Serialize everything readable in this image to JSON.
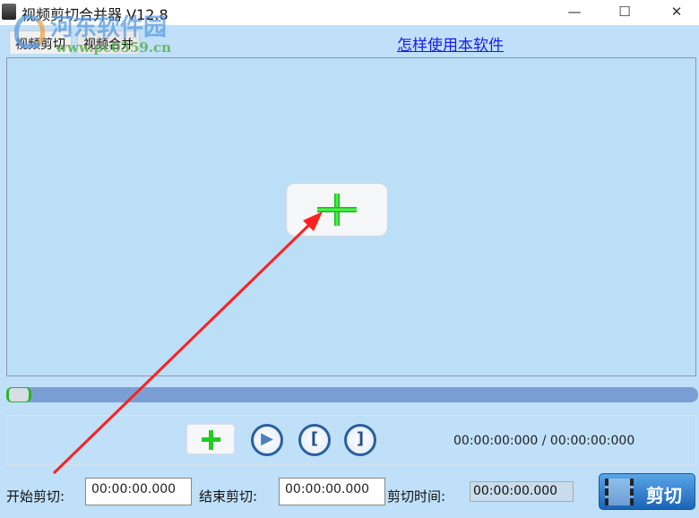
{
  "window": {
    "title": "视频剪切合并器 V12.8",
    "minimize": "—",
    "maximize": "☐",
    "close": "✕"
  },
  "tabs": [
    {
      "label": "视频剪切"
    },
    {
      "label": "视频合并"
    }
  ],
  "help_link": "怎样使用本软件",
  "seek": {
    "position_fraction": 0
  },
  "time_display": "00:00:00:000 / 00:00:00:000",
  "controls": {
    "open": "+",
    "play": "▶",
    "mark_in": "[",
    "mark_out": "]"
  },
  "start_label": "开始剪切:",
  "start_value": "00:00:00.000",
  "end_label": "结束剪切:",
  "end_value": "00:00:00.000",
  "duration_label": "剪切时间:",
  "duration_value": "00:00:00.000",
  "cut_button": "剪切",
  "watermark": {
    "name": "河东软件园",
    "url": "www.pc0359.cn"
  },
  "annotation_color": "#ff2020"
}
